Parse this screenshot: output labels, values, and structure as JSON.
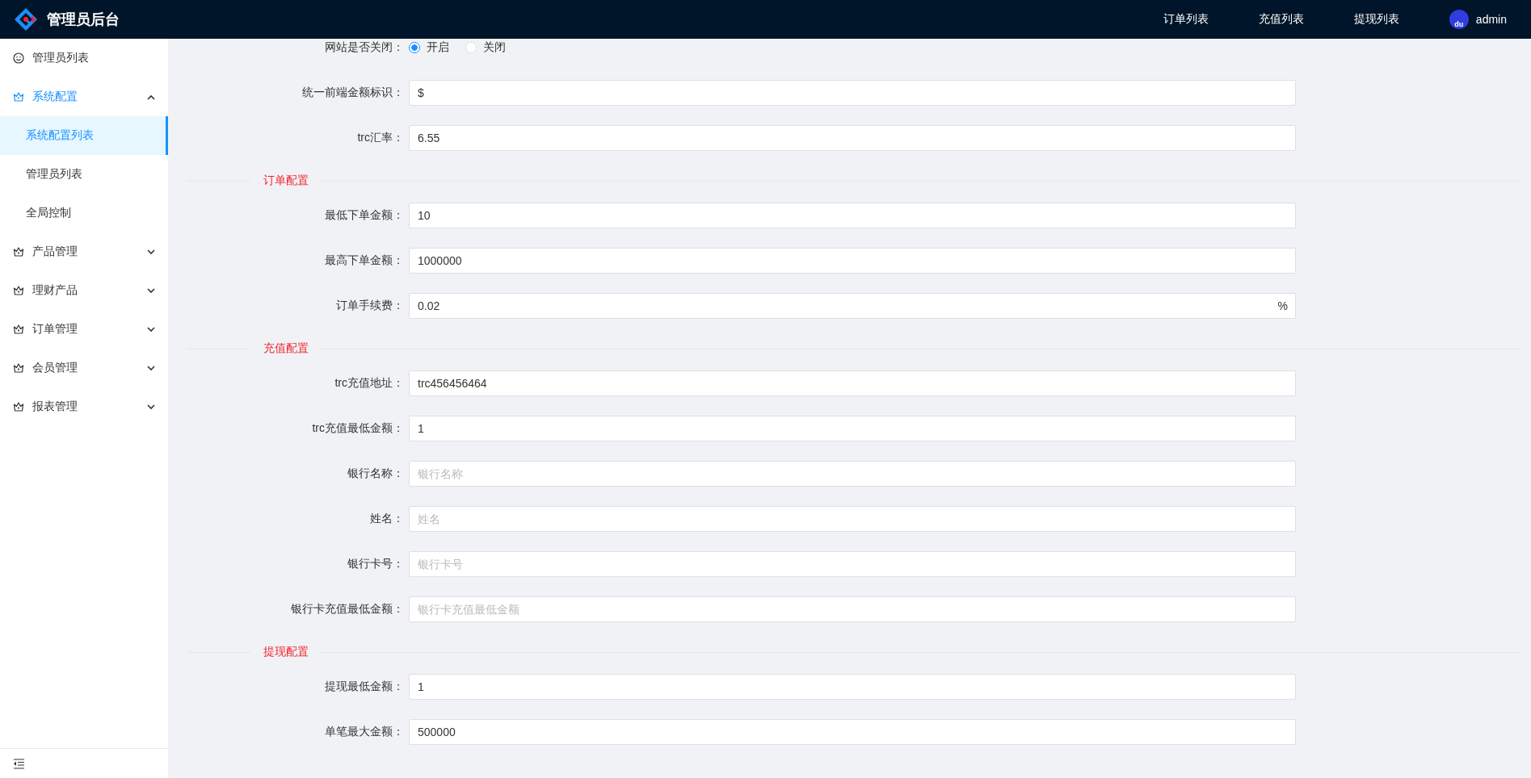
{
  "header": {
    "title": "管理员后台",
    "nav": [
      {
        "label": "订单列表"
      },
      {
        "label": "充值列表"
      },
      {
        "label": "提现列表"
      }
    ],
    "user": {
      "avatar_text": "du",
      "name": "admin"
    }
  },
  "sidebar": {
    "items": [
      {
        "label": "管理员列表",
        "kind": "link",
        "selected": false
      },
      {
        "label": "系统配置",
        "kind": "group",
        "selected": true,
        "expanded": true,
        "children": [
          {
            "label": "系统配置列表",
            "selected": true
          },
          {
            "label": "管理员列表",
            "selected": false
          },
          {
            "label": "全局控制",
            "selected": false
          }
        ]
      },
      {
        "label": "产品管理",
        "kind": "group",
        "selected": false,
        "expanded": false
      },
      {
        "label": "理财产品",
        "kind": "group",
        "selected": false,
        "expanded": false
      },
      {
        "label": "订单管理",
        "kind": "group",
        "selected": false,
        "expanded": false
      },
      {
        "label": "会员管理",
        "kind": "group",
        "selected": false,
        "expanded": false
      },
      {
        "label": "报表管理",
        "kind": "group",
        "selected": false,
        "expanded": false
      }
    ]
  },
  "form": {
    "items": [
      {
        "kind": "radio",
        "label": "网站是否关闭：",
        "options": [
          {
            "label": "开启",
            "selected": true
          },
          {
            "label": "关闭",
            "selected": false
          }
        ]
      },
      {
        "kind": "input",
        "label": "统一前端金额标识：",
        "value": "$"
      },
      {
        "kind": "input",
        "label": "trc汇率：",
        "value": "6.55"
      },
      {
        "kind": "section",
        "title": "订单配置"
      },
      {
        "kind": "input",
        "label": "最低下单金额：",
        "value": "10"
      },
      {
        "kind": "input",
        "label": "最高下单金额：",
        "value": "1000000"
      },
      {
        "kind": "input",
        "label": "订单手续费：",
        "value": "0.02",
        "suffix": "%"
      },
      {
        "kind": "section",
        "title": "充值配置"
      },
      {
        "kind": "input",
        "label": "trc充值地址：",
        "value": "trc456456464"
      },
      {
        "kind": "input",
        "label": "trc充值最低金额：",
        "value": "1"
      },
      {
        "kind": "input",
        "label": "银行名称：",
        "placeholder": "银行名称"
      },
      {
        "kind": "input",
        "label": "姓名：",
        "placeholder": "姓名"
      },
      {
        "kind": "input",
        "label": "银行卡号：",
        "placeholder": "银行卡号"
      },
      {
        "kind": "input",
        "label": "银行卡充值最低金额：",
        "placeholder": "银行卡充值最低金额"
      },
      {
        "kind": "section",
        "title": "提现配置"
      },
      {
        "kind": "input",
        "label": "提现最低金额：",
        "value": "1"
      },
      {
        "kind": "input",
        "label": "单笔最大金额：",
        "value": "500000"
      }
    ]
  }
}
